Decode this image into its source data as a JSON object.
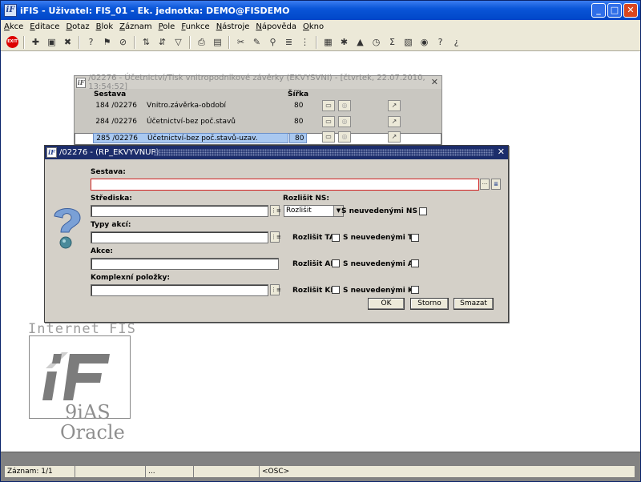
{
  "window": {
    "title": "iFIS - Uživatel: FIS_01 - Ek. jednotka: DEMO@FISDEMO",
    "app_icon": "iF"
  },
  "menu": [
    "Akce",
    "Editace",
    "Dotaz",
    "Blok",
    "Záznam",
    "Pole",
    "Funkce",
    "Nástroje",
    "Nápověda",
    "Okno"
  ],
  "toolbar": {
    "exit_label": "EXIT"
  },
  "report_window": {
    "title": "/02276 - Účetnictví/Tisk vnitropodnikové závěrky (EKVYSVNI) - [čtvrtek, 22.07.2010, 13:54:52]",
    "col_sestava": "Sestava",
    "col_sirka": "Šířka",
    "rows": [
      {
        "num": "184 /02276",
        "name": "Vnitro.závěrka-období",
        "width": "80"
      },
      {
        "num": "284 /02276",
        "name": "Účetnictví-bez poč.stavů",
        "width": "80"
      },
      {
        "num": "285 /02276",
        "name": "Účetnictví-bez poč.stavů-uzav.",
        "width": "80"
      }
    ]
  },
  "dialog": {
    "title": "/02276 - (RP_EKVYVNUP)",
    "sestava_label": "Sestava:",
    "sestava_value": "",
    "strediska_label": "Střediska:",
    "strediska_value": "",
    "rozlisit_ns_label": "Rozlišit NS:",
    "rozlisit_ns_value": "Rozlišit",
    "s_neuvedenymi_ns": "S neuvedenými NS",
    "typy_akci_label": "Typy akcí:",
    "typy_akci_value": "",
    "rozlisit_ta": "Rozlišit TA",
    "s_neuvedenymi_ta": "S neuvedenými TA",
    "akce_label": "Akce:",
    "akce_value": "",
    "rozlisit_ak": "Rozlišit AK",
    "s_neuvedenymi_ak": "S neuvedenými AK",
    "komplexni_label": "Komplexní položky:",
    "komplexni_value": "",
    "rozlisit_kp": "Rozlišit KP",
    "s_neuvedenymi_kp": "S neuvedenými KP",
    "ok_label": "OK",
    "storno_label": "Storno",
    "smazat_label": "Smazat"
  },
  "logo": {
    "line1": "Internet FIS",
    "line2": "9iAS",
    "line3": "Oracle"
  },
  "status": {
    "record": "Záznam: 1/1",
    "ellipsis": "...",
    "mode": "<OSC>"
  }
}
